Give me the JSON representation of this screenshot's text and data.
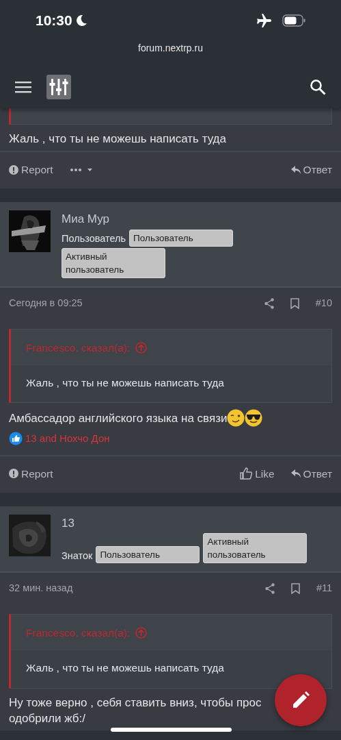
{
  "status_bar": {
    "time": "10:30"
  },
  "browser": {
    "url": "forum.nextrp.ru"
  },
  "posts": [
    {
      "kind": "partial",
      "body": [
        "Жаль , что ты не можешь написать туда"
      ],
      "left_actions": [
        {
          "kind": "report",
          "label": "Report"
        },
        {
          "kind": "more"
        }
      ],
      "right_actions": [
        {
          "kind": "reply",
          "label": "Ответ"
        }
      ]
    },
    {
      "kind": "full",
      "author": {
        "name": "Миа Мур",
        "title": "Пользователь",
        "banners": [
          "Пользователь",
          "Активный пользователь"
        ]
      },
      "date": "Сегодня в 09:25",
      "number": "#10",
      "quote": {
        "author": "Francesco. сказал(а):",
        "text": "Жаль , что ты не можешь написать туда"
      },
      "body": [
        "Амбассадор английского языка на связи"
      ],
      "emojis": [
        {
          "kind": "wink"
        },
        {
          "kind": "sunglasses"
        }
      ],
      "reactions": "13 and Нохчо Дон",
      "left_actions": [
        {
          "kind": "report",
          "label": "Report"
        }
      ],
      "right_actions": [
        {
          "kind": "like",
          "label": "Like"
        },
        {
          "kind": "reply",
          "label": "Ответ"
        }
      ]
    },
    {
      "kind": "full",
      "author": {
        "name": "13",
        "title": "Знаток",
        "banners": [
          "Пользователь",
          "Активный пользователь"
        ]
      },
      "date": "32 мин. назад",
      "number": "#11",
      "quote": {
        "author": "Francesco. сказал(а):",
        "text": "Жаль , что ты не можешь написать туда"
      },
      "body": [
        "Ну тоже верно , себя ставить вниз, чтобы прос",
        "одобрили жб:/"
      ]
    }
  ]
}
